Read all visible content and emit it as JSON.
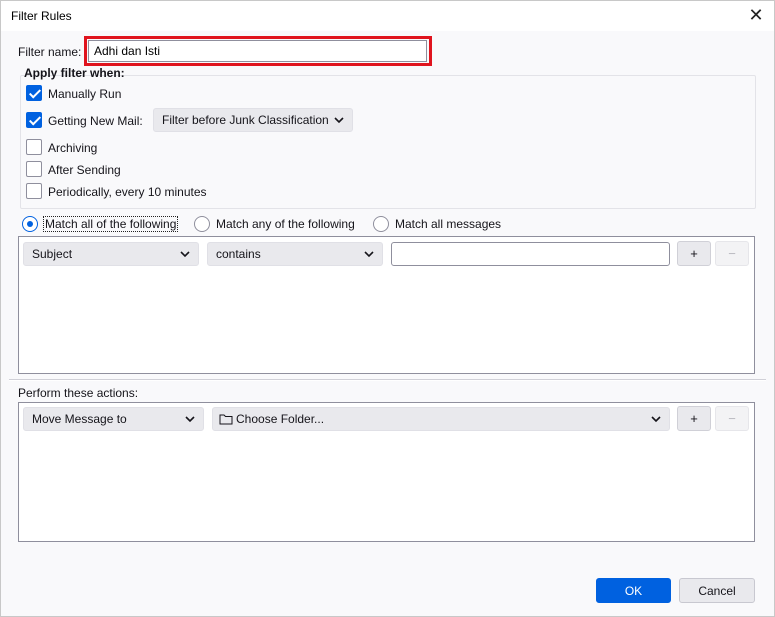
{
  "window": {
    "title": "Filter Rules",
    "close_glyph": "✕"
  },
  "filter_name": {
    "label": "Filter name:",
    "value": "Adhi dan Isti"
  },
  "apply_when": {
    "heading": "Apply filter when:",
    "manually_run": {
      "label": "Manually Run",
      "checked": true
    },
    "getting_new_mail": {
      "label": "Getting New Mail:",
      "checked": true
    },
    "timing_select": "Filter before Junk Classification",
    "archiving": {
      "label": "Archiving",
      "checked": false
    },
    "after_sending": {
      "label": "After Sending",
      "checked": false
    },
    "periodically": {
      "label": "Periodically, every 10 minutes",
      "checked": false
    }
  },
  "match": {
    "all": "Match all of the following",
    "any": "Match any of the following",
    "all_messages": "Match all messages",
    "selected": "all"
  },
  "criteria": {
    "field": "Subject",
    "operator": "contains",
    "value": "",
    "add": "+",
    "remove": "−"
  },
  "actions": {
    "heading": "Perform these actions:",
    "action": "Move Message to",
    "folder": "Choose Folder...",
    "add": "+",
    "remove": "−"
  },
  "buttons": {
    "ok": "OK",
    "cancel": "Cancel"
  },
  "colors": {
    "accent": "#0061e0",
    "highlight": "#e0141e"
  }
}
